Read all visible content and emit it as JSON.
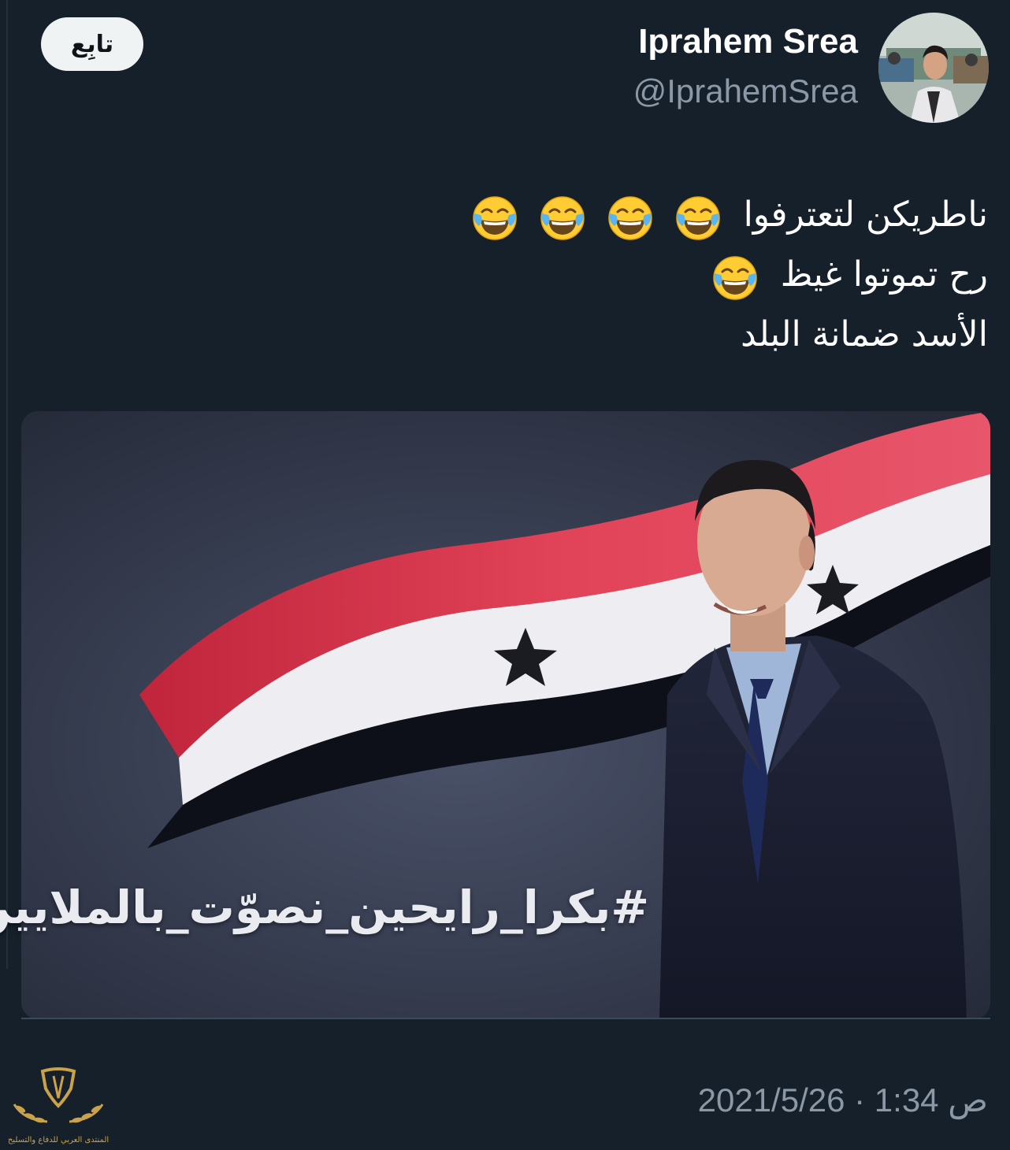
{
  "header": {
    "display_name": "Iprahem Srea",
    "handle": "@IprahemSrea",
    "follow_label": "تابِع"
  },
  "tweet": {
    "lines": [
      {
        "text": "ناطريكن لتعترفوا",
        "emoji_count": 4
      },
      {
        "text": "رح تموتوا غيظ",
        "emoji_count": 1
      },
      {
        "text": "الأسد ضمانة البلد",
        "emoji_count": 0
      }
    ],
    "emoji_name": "face-with-tears-of-joy-emoji",
    "media": {
      "hashtag": "#بكرا_رايحين_نصوّت_بالملايين",
      "flag_colors": [
        "#d9344a",
        "#f2f2f4",
        "#11131c"
      ]
    }
  },
  "footer": {
    "timestamp": "2021/5/26 · 1:34 ص",
    "watermark_text": "المنتدى العربي للدفاع والتسليح"
  },
  "colors": {
    "background": "#15202b",
    "text_secondary": "#8b98a5",
    "follow_button_bg": "#eff3f4",
    "emoji_yellow": "#ffcc33",
    "tear_blue": "#5ab4f0"
  }
}
